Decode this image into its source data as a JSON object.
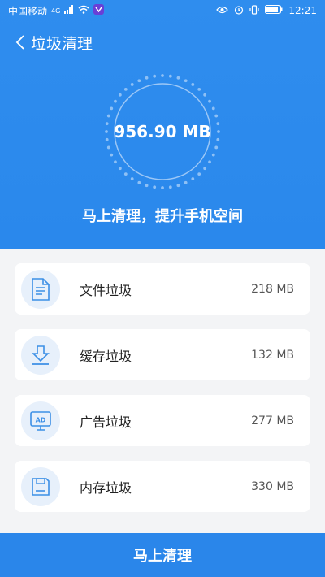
{
  "status_bar": {
    "carrier": "中国移动",
    "network": "4G",
    "time": "12:21"
  },
  "header": {
    "title": "垃圾清理",
    "total_size": "956.90 MB",
    "subtitle": "马上清理，提升手机空间"
  },
  "items": [
    {
      "label": "文件垃圾",
      "size": "218 MB",
      "icon": "document-icon"
    },
    {
      "label": "缓存垃圾",
      "size": "132 MB",
      "icon": "download-icon"
    },
    {
      "label": "广告垃圾",
      "size": "277 MB",
      "icon": "ad-monitor-icon"
    },
    {
      "label": "内存垃圾",
      "size": "330 MB",
      "icon": "memory-card-icon"
    }
  ],
  "action_button": {
    "label": "马上清理"
  },
  "colors": {
    "primary": "#2a88ec",
    "icon_stroke": "#3c8fe6",
    "icon_bg": "#e7f0fb",
    "page_bg": "#f3f4f6"
  }
}
